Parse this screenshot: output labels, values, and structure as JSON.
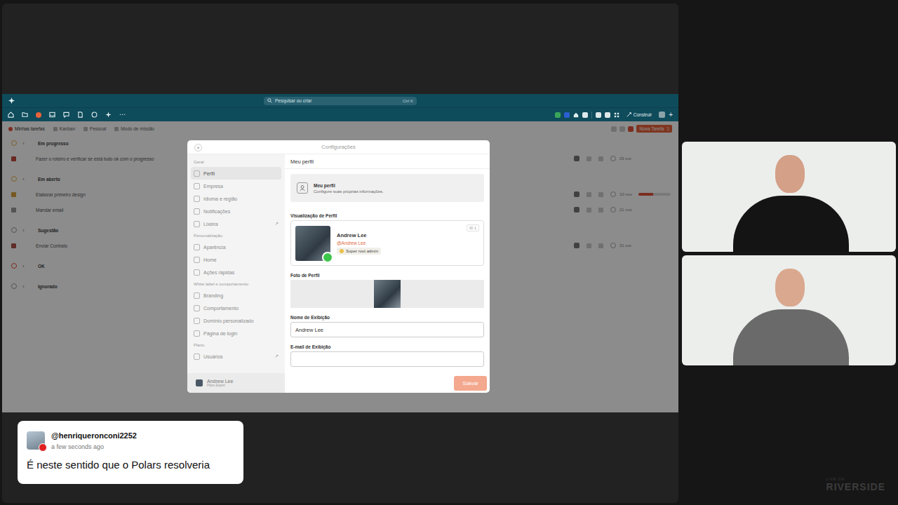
{
  "stream": {
    "watermark_top": "LIVE ON",
    "watermark": "RIVERSIDE"
  },
  "app": {
    "search": {
      "placeholder": "Pesquisar ou criar",
      "shortcut": "Ctrl K"
    },
    "nav_more": "⋯",
    "build_button": "Construir",
    "add_button": "+",
    "toolbar": {
      "tabs": [
        {
          "label": "Minhas tarefas",
          "selected": true
        },
        {
          "label": "Kanban",
          "selected": false
        },
        {
          "label": "Pessoal",
          "selected": false
        },
        {
          "label": "Modo de missão",
          "selected": false
        }
      ],
      "new_button": "Nova Tarefa",
      "new_count": "1"
    },
    "groups": [
      {
        "title": "Em progresso",
        "color": "#e2b04a",
        "tasks": [
          {
            "title": "Fazer o roteiro e verificar se está tudo ok com o progresso",
            "date": "29 out",
            "color": "#c0493b"
          }
        ]
      },
      {
        "title": "Em aberto",
        "color": "#e2b04a",
        "tasks": [
          {
            "title": "Elaborar primeiro design",
            "date": "10 nov",
            "color": "#d9a43d",
            "level": 0.45
          },
          {
            "title": "Mandar email",
            "date": "21 nov",
            "color": "#9a9a9a"
          }
        ]
      },
      {
        "title": "Sugestão",
        "color": "#9a9a9a",
        "tasks": [
          {
            "title": "Enviar Contrato",
            "date": "31 out",
            "color": "#b0504a"
          }
        ]
      },
      {
        "title": "OK",
        "color": "#e0533a",
        "tasks": []
      },
      {
        "title": "Ignorado",
        "color": "#9a9a9a",
        "tasks": []
      }
    ]
  },
  "settings": {
    "title": "Configurações",
    "close": "×",
    "external_icon": "↗",
    "sections": [
      {
        "title": "Geral",
        "items": [
          {
            "label": "Perfil",
            "selected": true,
            "external": false
          },
          {
            "label": "Empresa",
            "selected": false,
            "external": false
          },
          {
            "label": "Idioma e região",
            "selected": false,
            "external": false
          },
          {
            "label": "Notificações",
            "selected": false,
            "external": false
          },
          {
            "label": "Lixeira",
            "selected": false,
            "external": true
          }
        ]
      },
      {
        "title": "Personalização",
        "items": [
          {
            "label": "Aparência",
            "selected": false,
            "external": false
          },
          {
            "label": "Home",
            "selected": false,
            "external": false
          },
          {
            "label": "Ações rápidas",
            "selected": false,
            "external": false
          }
        ]
      },
      {
        "title": "White label e comportamento",
        "items": [
          {
            "label": "Branding",
            "selected": false,
            "external": false
          },
          {
            "label": "Comportamento",
            "selected": false,
            "external": false
          },
          {
            "label": "Domínio personalizado",
            "selected": false,
            "external": false
          },
          {
            "label": "Página de login",
            "selected": false,
            "external": false
          }
        ]
      },
      {
        "title": "Plano",
        "items": [
          {
            "label": "Usuários",
            "selected": false,
            "external": true
          }
        ]
      }
    ],
    "user": {
      "name": "Andrew Lee",
      "plan": "Plano Expert"
    },
    "page_title": "Meu perfil",
    "header_card": {
      "title": "Meu perfil",
      "subtitle": "Configure suas próprias informações."
    },
    "preview": {
      "label": "Visualização de Perfil",
      "name": "Andrew Lee",
      "handle": "@Andrew Lee",
      "role": "Super root admin",
      "id": "ID 1",
      "online": true
    },
    "photo": {
      "label": "Foto de Perfil"
    },
    "fields": [
      {
        "label": "Nome de Exibição",
        "value": "Andrew Lee"
      },
      {
        "label": "E-mail de Exibição",
        "value": ""
      }
    ],
    "save_button": "Salvar"
  },
  "comment": {
    "author": "@henriqueronconi2252",
    "time": "a few seconds ago",
    "text": "É neste sentido que o Polars resolveria"
  }
}
